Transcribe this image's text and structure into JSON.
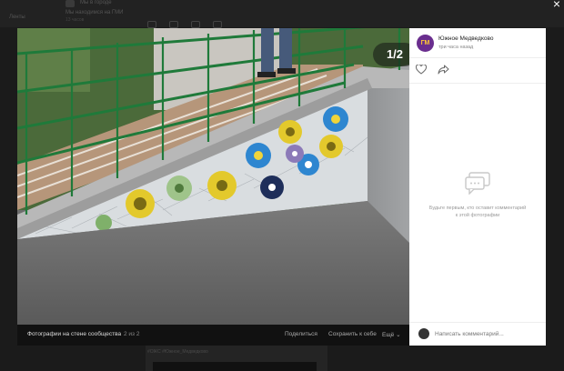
{
  "background": {
    "feed_name": "Мы в городе",
    "feed_subtitle": "Мы находимся на ГМИ",
    "feed_meta": "13 часов",
    "left_nav": "Ленты",
    "feed_hashtag": "#ОЖС #Южное_Медведково"
  },
  "viewer": {
    "counter": "1/2",
    "album_title": "Фотографии на стене сообщества",
    "album_count": "2 из 2",
    "actions": {
      "share": "Поделиться",
      "save": "Сохранить к себе",
      "more": "Ещё ⌄"
    },
    "close": "×"
  },
  "side": {
    "group_initials": "ГМ",
    "group_name": "Южное Медведково",
    "time": "три часа назад",
    "empty_comments": "Будьте первым, кто оставит комментарий к этой фотографии",
    "comment_placeholder": "Написать комментарий..."
  },
  "colors": {
    "accent_avatar": "#6a2e8e",
    "railing": "#1f7a3a"
  }
}
